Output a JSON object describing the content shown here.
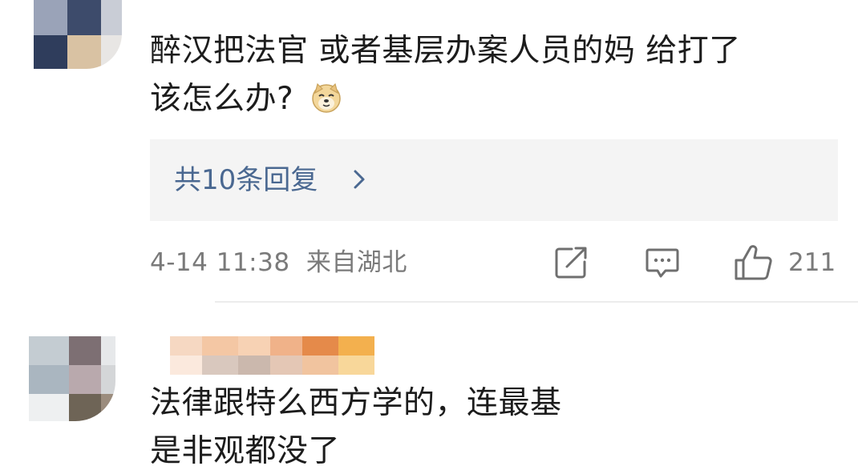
{
  "comments": [
    {
      "text_line1": "醉汉把法官 或者基层办案人员的妈 给打了",
      "text_line2": "该怎么办?",
      "emoji": "doge-emoji",
      "replies_label": "共10条回复",
      "timestamp": "4-14 11:38",
      "location": "来自湖北",
      "like_count": "211",
      "icons": [
        "share-icon",
        "comment-icon",
        "like-icon",
        "chevron-right-icon"
      ]
    },
    {
      "text_line1": "法律跟特么西方学的，连最基",
      "text_line2": "是非观都没了",
      "username_pixelated": true
    }
  ],
  "colors": {
    "text": "#1c1c1c",
    "meta": "#7a7a7a",
    "link": "#4a6891",
    "reply_bg": "#f4f4f4"
  }
}
